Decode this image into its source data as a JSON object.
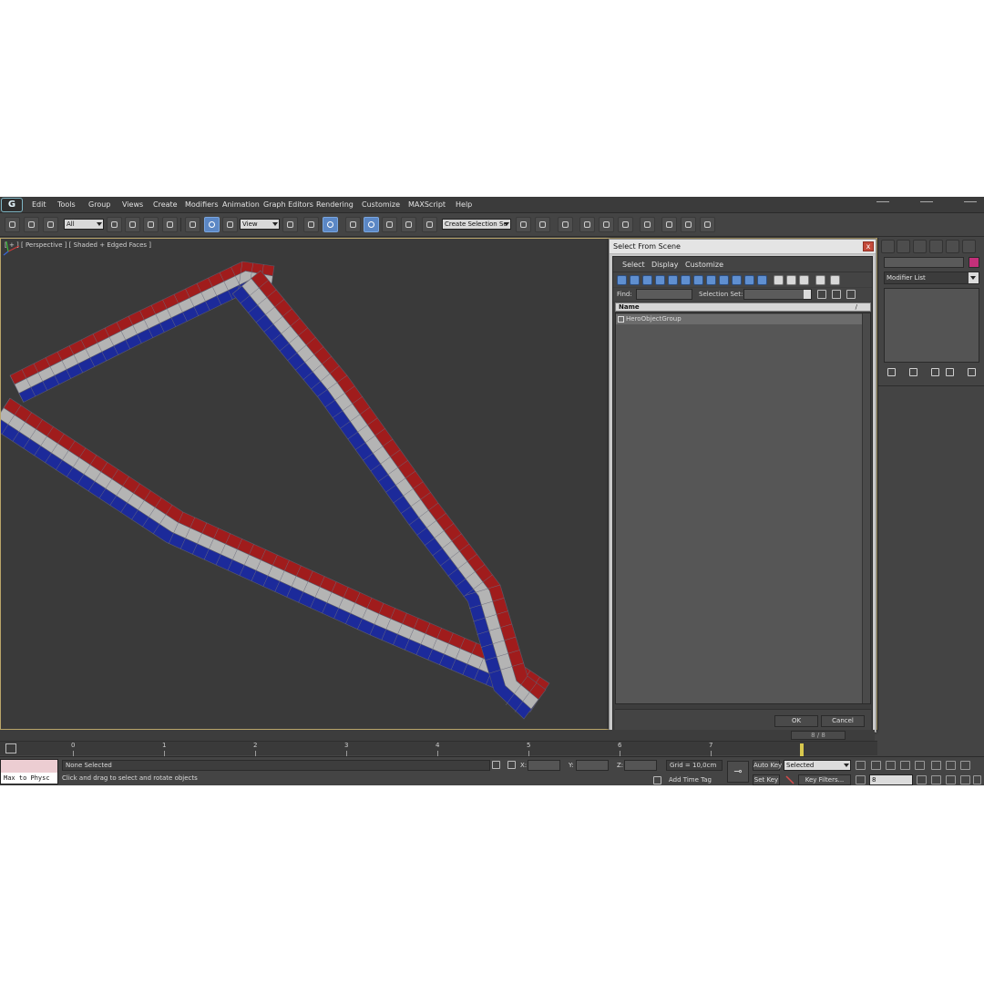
{
  "menu": {
    "items": [
      "Edit",
      "Tools",
      "Group",
      "Views",
      "Create",
      "Modifiers",
      "Animation",
      "Graph Editors",
      "Rendering",
      "Customize",
      "MAXScript",
      "Help"
    ]
  },
  "toolbar": {
    "selection_filter": "All",
    "reference_coord": "View",
    "named_selection": "Create Selection Se"
  },
  "viewport": {
    "label": "[ + ] [ Perspective ] [ Shaded + Edged Faces ]",
    "stripe_colors": {
      "red": "#a01c1c",
      "white": "#b4b4b4",
      "blue": "#1c2a9a"
    }
  },
  "command_panel": {
    "modifier_list": "Modifier List",
    "object_color": "#c4307a"
  },
  "dialog": {
    "title": "Select From Scene",
    "close_glyph": "x",
    "menu": [
      "Select",
      "Display",
      "Customize"
    ],
    "find_label": "Find:",
    "selection_set_label": "Selection Set:",
    "column_name": "Name",
    "column_sort": "/",
    "rows": [
      {
        "label": "HeroObjectGroup"
      }
    ],
    "ok": "OK",
    "cancel": "Cancel"
  },
  "timeline": {
    "frame_indicator": "8 / 8",
    "ruler": [
      "0",
      "1",
      "2",
      "3",
      "4",
      "5",
      "6",
      "7"
    ]
  },
  "status": {
    "maxscript": "Max to Physc",
    "selection": "None Selected",
    "prompt": "Click and drag to select and rotate objects",
    "x_label": "X:",
    "y_label": "Y:",
    "z_label": "Z:",
    "grid": "Grid = 10,0cm",
    "add_time_tag": "Add Time Tag",
    "auto_key": "Auto Key",
    "set_key": "Set Key",
    "key_mode": "Selected",
    "key_filters": "Key Filters...",
    "current_frame": "8"
  }
}
